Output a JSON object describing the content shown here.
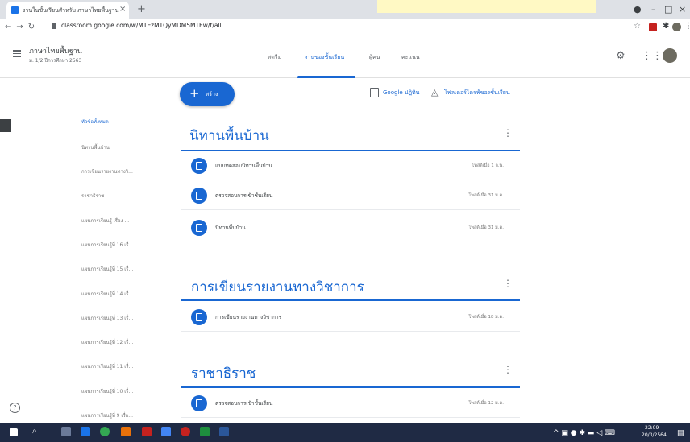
{
  "browser": {
    "tab_title": "งานในชั้นเรียนสำหรับ ภาษาไทยพื้นฐาน",
    "tab_close": "×",
    "new_tab": "+",
    "url": "classroom.google.com/w/MTEzMTQyMDM5MTEw/t/all",
    "window_controls": [
      "●",
      "–",
      "□",
      "×"
    ]
  },
  "classroom": {
    "title": "ภาษาไทยพื้นฐาน",
    "subtitle": "ม. 1/2 ปีการศึกษา 2563",
    "tabs": [
      {
        "label": "สตรีม"
      },
      {
        "label": "งานของชั้นเรียน"
      },
      {
        "label": "ผู้คน"
      },
      {
        "label": "คะแนน"
      }
    ]
  },
  "sidebar": {
    "items": [
      "หัวข้อทั้งหมด",
      "นิทานพื้นบ้าน",
      "การเขียนรายงานทางวิ...",
      "ราชาธิราช",
      "แผนการเรียนรู้ เรื่อง ...",
      "แผนการเรียนรู้ที่ 16 เรื่...",
      "แผนการเรียนรู้ที่ 15 เรื่...",
      "แผนการเรียนรู้ที่ 14 เรื่...",
      "แผนการเรียนรู้ที่ 13 เรื่...",
      "แผนการเรียนรู้ที่ 12 เรื่...",
      "แผนการเรียนรู้ที่ 11 เรื่...",
      "แผนการเรียนรู้ที่ 10 เรื่...",
      "แผนการเรียนรู้ที่ 9 เรื่อ..."
    ]
  },
  "toolbar": {
    "create_label": "สร้าง",
    "create_plus": "+",
    "calendar_label": "Google ปฏิทิน",
    "drive_label": "โฟลเดอร์ไดรฟ์ของชั้นเรียน"
  },
  "sections": [
    {
      "title": "นิทานพื้นบ้าน",
      "rows": [
        {
          "label": "แบบทดสอบนิทานพื้นบ้าน",
          "date": "โพสต์เมื่อ 1 ก.พ."
        },
        {
          "label": "ตรวจสอบการเข้าชั้นเรียน",
          "date": "โพสต์เมื่อ 31 ม.ค."
        },
        {
          "label": "นิทานพื้นบ้าน",
          "date": "โพสต์เมื่อ 31 ม.ค."
        }
      ]
    },
    {
      "title": "การเขียนรายงานทางวิชาการ",
      "rows": [
        {
          "label": "การเขียนรายงานทางวิชาการ",
          "date": "โพสต์เมื่อ 18 ม.ค."
        }
      ]
    },
    {
      "title": "ราชาธิราช",
      "rows": [
        {
          "label": "ตรวจสอบการเข้าชั้นเรียน",
          "date": "โพสต์เมื่อ 12 ม.ค."
        }
      ]
    }
  ],
  "taskbar": {
    "time": "22:09",
    "date": "20/3/2564"
  },
  "colors": {
    "accent": "#1967d2",
    "taskbar": "#1f2a44",
    "tabbar": "#dee1e6"
  }
}
